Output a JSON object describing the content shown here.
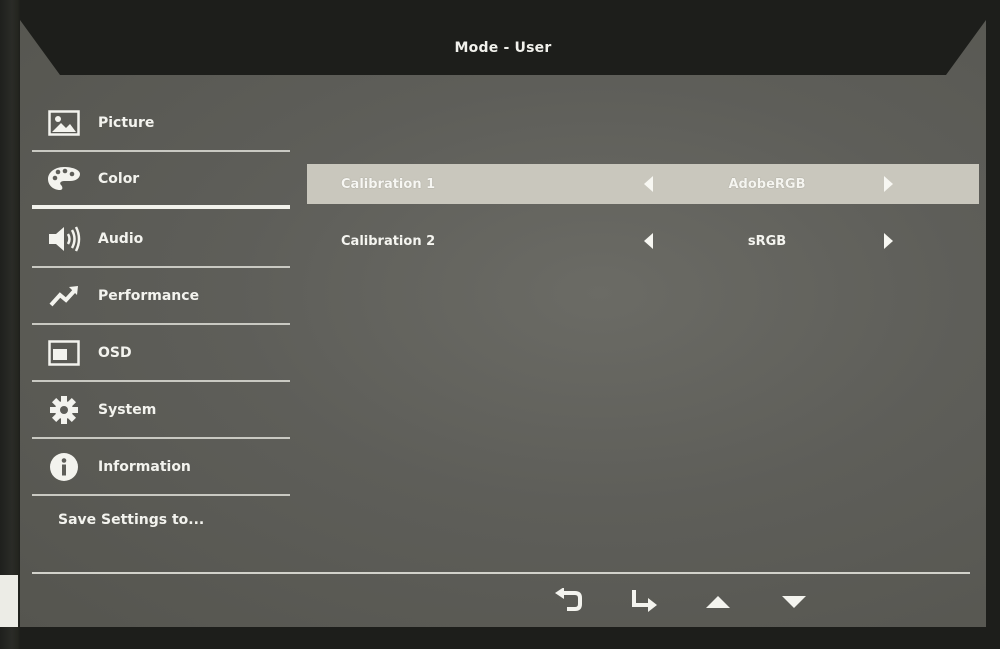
{
  "header": {
    "title": "Mode - User"
  },
  "sidebar": {
    "items": [
      {
        "label": "Picture",
        "icon": "picture-icon"
      },
      {
        "label": "Color",
        "icon": "palette-icon",
        "active": true
      },
      {
        "label": "Audio",
        "icon": "speaker-icon"
      },
      {
        "label": "Performance",
        "icon": "trend-up-icon"
      },
      {
        "label": "OSD",
        "icon": "osd-window-icon"
      },
      {
        "label": "System",
        "icon": "gear-icon"
      },
      {
        "label": "Information",
        "icon": "info-icon"
      }
    ],
    "save_label": "Save Settings to..."
  },
  "settings": [
    {
      "label": "Calibration 1",
      "value": "AdobeRGB",
      "selected": true
    },
    {
      "label": "Calibration 2",
      "value": "sRGB",
      "selected": false
    }
  ],
  "footer": {
    "buttons": [
      {
        "icon": "back-arrow-icon"
      },
      {
        "icon": "enter-arrow-icon"
      },
      {
        "icon": "up-triangle-icon"
      },
      {
        "icon": "down-triangle-icon"
      }
    ]
  },
  "colors": {
    "panel_bg": "#5e5e59",
    "selected_row": "#c9c7bd",
    "text": "#f3f3ee"
  }
}
